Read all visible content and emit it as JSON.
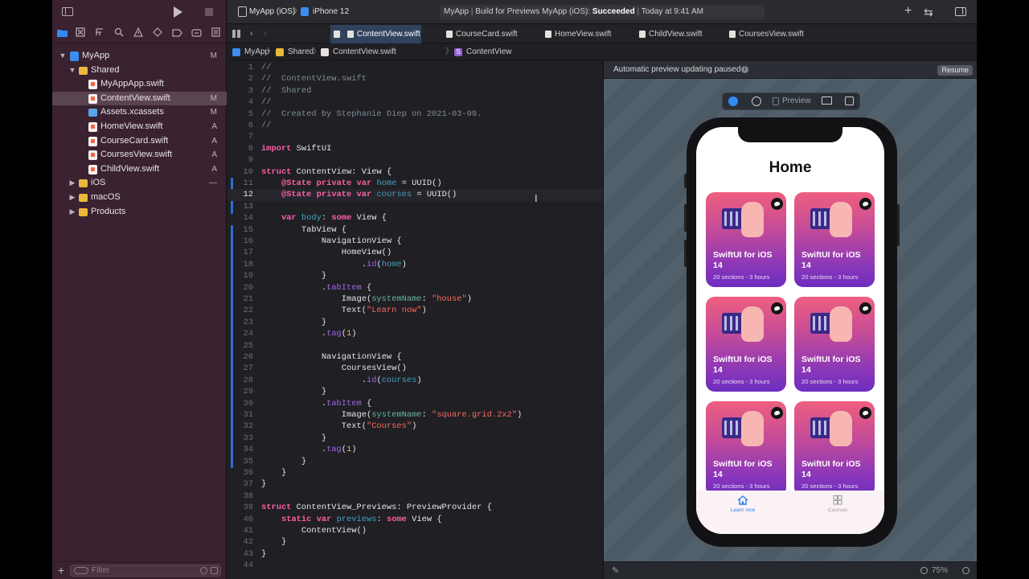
{
  "toolbar": {
    "scheme": "MyApp (iOS)",
    "device": "iPhone 12",
    "status_app": "MyApp",
    "status_build": "Build for Previews MyApp (iOS):",
    "status_result": "Succeeded",
    "status_time": "Today at 9:41 AM"
  },
  "tabs": [
    {
      "label": "ContentView.swift"
    },
    {
      "label": "CourseCard.swift"
    },
    {
      "label": "HomeView.swift"
    },
    {
      "label": "ChildView.swift"
    },
    {
      "label": "CoursesView.swift"
    }
  ],
  "jumpbar": {
    "project": "MyApp",
    "group": "Shared",
    "file": "ContentView.swift",
    "symbol": "ContentView"
  },
  "navigator": {
    "items": [
      {
        "label": "MyApp",
        "status": "M"
      },
      {
        "label": "Shared",
        "status": ""
      },
      {
        "label": "MyAppApp.swift",
        "status": ""
      },
      {
        "label": "ContentView.swift",
        "status": "M"
      },
      {
        "label": "Assets.xcassets",
        "status": "M"
      },
      {
        "label": "HomeView.swift",
        "status": "A"
      },
      {
        "label": "CourseCard.swift",
        "status": "A"
      },
      {
        "label": "CoursesView.swift",
        "status": "A"
      },
      {
        "label": "ChildView.swift",
        "status": "A"
      },
      {
        "label": "iOS",
        "status": "—"
      },
      {
        "label": "macOS",
        "status": ""
      },
      {
        "label": "Products",
        "status": ""
      }
    ],
    "filter_placeholder": "Filter"
  },
  "canvas": {
    "notice": "Automatic preview updating paused",
    "resume": "Resume",
    "preview_label": "Preview",
    "zoom": "75%"
  },
  "app_preview": {
    "title": "Home",
    "cards": [
      {
        "title": "SwiftUI for iOS 14",
        "subtitle": "20 sections - 3 hours"
      },
      {
        "title": "SwiftUI for iOS 14",
        "subtitle": "20 sections - 3 hours"
      },
      {
        "title": "SwiftUI for iOS 14",
        "subtitle": "20 sections - 3 hours"
      },
      {
        "title": "SwiftUI for iOS 14",
        "subtitle": "20 sections - 3 hours"
      },
      {
        "title": "SwiftUI for iOS 14",
        "subtitle": "20 sections - 3 hours"
      },
      {
        "title": "SwiftUI for iOS 14",
        "subtitle": "20 sections - 3 hours"
      }
    ],
    "tab_learn": "Learn now",
    "tab_courses": "Courses"
  },
  "colors": {
    "accent": "#2f8cf5",
    "keyword": "#fc5fa3",
    "string": "#fc6a5d",
    "comment": "#7f8c98",
    "type": "#5dd8ff"
  },
  "code": [
    "//",
    "//  ContentView.swift",
    "//  Shared",
    "//",
    "//  Created by Stephanie Diep on 2021-03-09.",
    "//",
    "",
    "import SwiftUI",
    "",
    "struct ContentView: View {",
    "    @State private var home = UUID()",
    "    @State private var courses = UUID()",
    "",
    "    var body: some View {",
    "        TabView {",
    "            NavigationView {",
    "                HomeView()",
    "                    .id(home)",
    "            }",
    "            .tabItem {",
    "                Image(systemName: \"house\")",
    "                Text(\"Learn now\")",
    "            }",
    "            .tag(1)",
    "",
    "            NavigationView {",
    "                CoursesView()",
    "                    .id(courses)",
    "            }",
    "            .tabItem {",
    "                Image(systemName: \"square.grid.2x2\")",
    "                Text(\"Courses\")",
    "            }",
    "            .tag(1)",
    "        }",
    "    }",
    "}",
    "",
    "struct ContentView_Previews: PreviewProvider {",
    "    static var previews: some View {",
    "        ContentView()",
    "    }",
    "}",
    ""
  ]
}
